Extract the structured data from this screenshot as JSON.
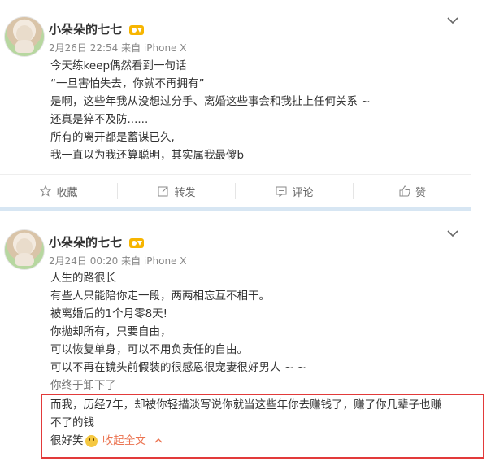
{
  "posts": [
    {
      "username": "小朵朵的七七",
      "meta": "2月26日 22:54 来自 iPhone X",
      "lines": [
        "今天练keep偶然看到一句话",
        "“一旦害怕失去，你就不再拥有”",
        "是啊，这些年我从没想过分手、离婚这些事会和我扯上任何关系 ~",
        "还真是猝不及防......",
        "所有的离开都是蓄谋已久,",
        "我一直以为我还算聪明，其实属我最傻b"
      ],
      "actions": {
        "favorite": "收藏",
        "repost": "转发",
        "comment": "评论",
        "like": "赞"
      }
    },
    {
      "username": "小朵朵的七七",
      "meta": "2月24日 00:20 来自 iPhone X",
      "lines": [
        "人生的路很长",
        "有些人只能陪你走一段，两两相忘互不相干。",
        "被离婚后的1个月零8天!",
        "你抛却所有，只要自由，",
        "可以恢复单身，可以不用负责任的自由。",
        "可以不再在镜头前假装的很感恩很宠妻很好男人 ~ ~",
        "你终于卸下了",
        "而我，历经7年，却被你轻描淡写说你就当这些年你去赚钱了，赚了你几辈子也赚",
        "不了的钱"
      ],
      "last_line_text": "很好笑",
      "collapse_label": "收起全文",
      "collapse_icon": "chevron-up-icon"
    }
  ],
  "colors": {
    "highlight_border": "#e23a3a",
    "link": "#eb7350",
    "separator": "#d7e6f3"
  }
}
